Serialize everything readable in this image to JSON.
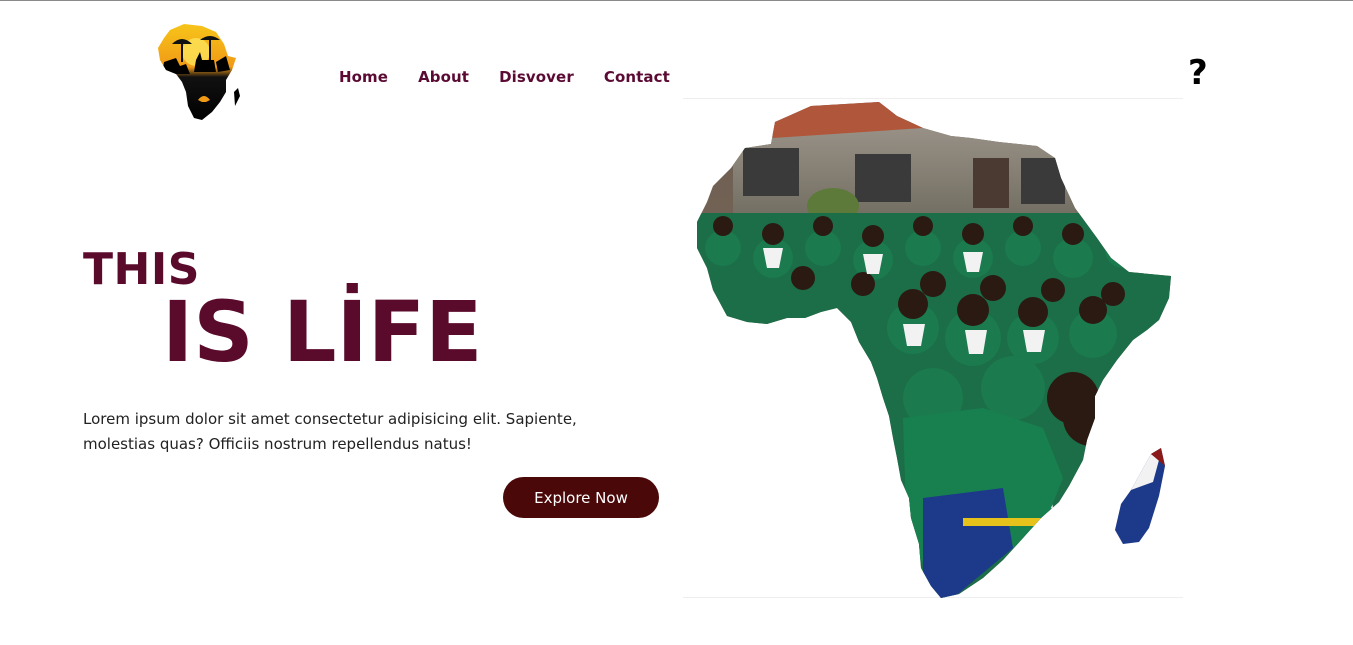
{
  "nav": {
    "items": [
      {
        "label": "Home"
      },
      {
        "label": "About"
      },
      {
        "label": "Disvover"
      },
      {
        "label": "Contact"
      }
    ]
  },
  "header": {
    "logo_icon": "africa-map-logo-icon",
    "help_icon": "question-mark-icon",
    "help_glyph": "?"
  },
  "hero": {
    "line1": "THIS",
    "line2": "IS LİFE",
    "description": "Lorem ipsum dolor sit amet consectetur adipisicing elit. Sapiente, molestias quas? Officiis nostrum repellendus natus!",
    "cta_label": "Explore Now",
    "image_icon": "africa-map-photo-icon"
  },
  "colors": {
    "brand": "#5a0a2a",
    "nav_text": "#5a0a33",
    "button": "#4a0808",
    "uniform_green": "#1b7a4e"
  }
}
